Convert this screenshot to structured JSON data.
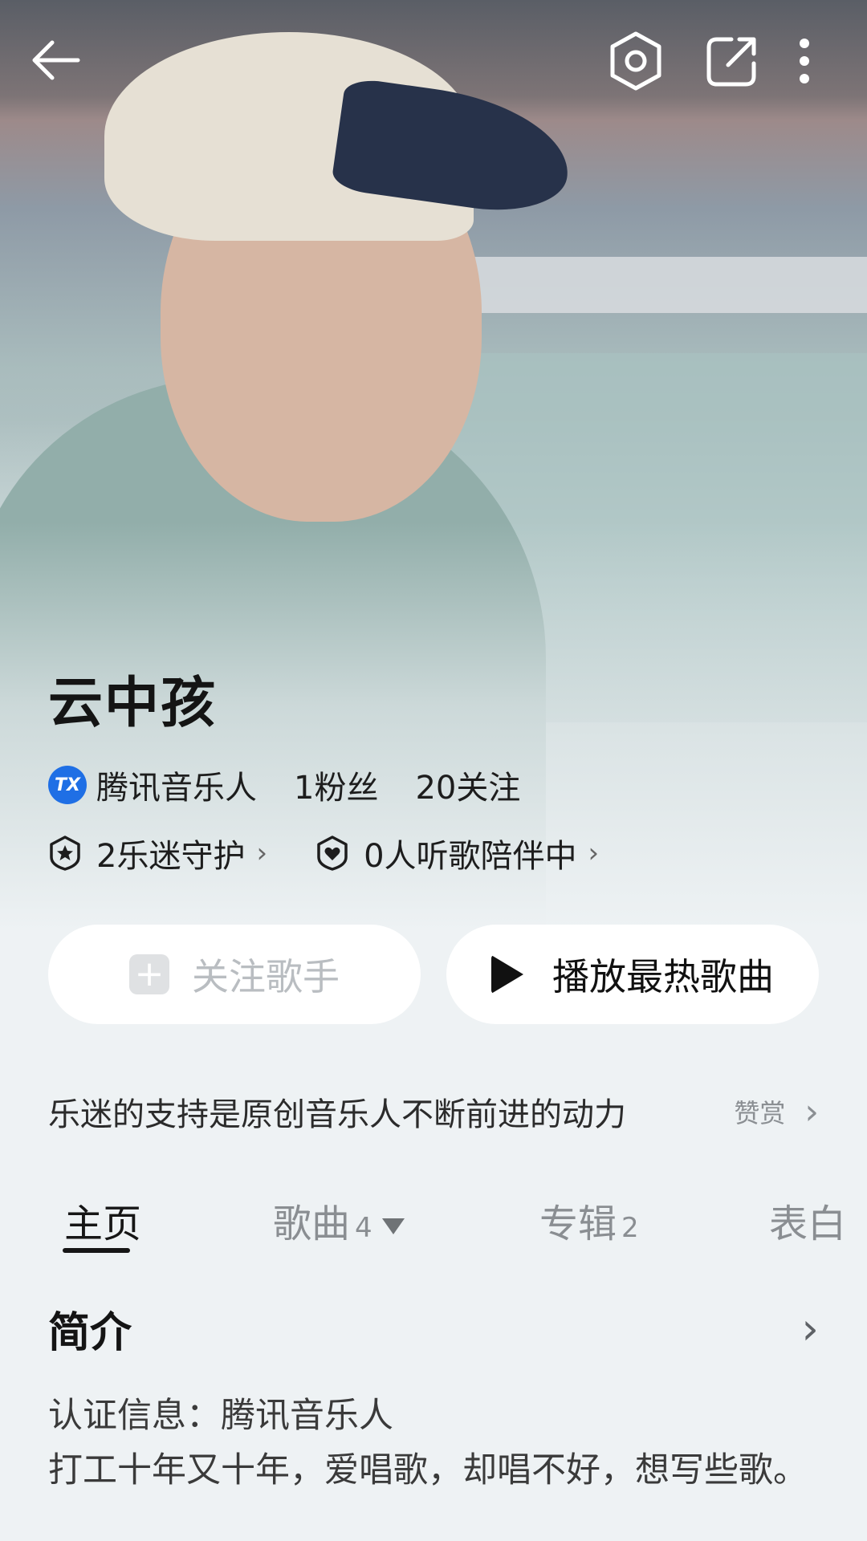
{
  "artist": {
    "name": "云中孩",
    "badge_text": "TX",
    "verification": "腾讯音乐人",
    "fans": "1粉丝",
    "following": "20关注",
    "guardians": "2乐迷守护",
    "listening": "0人听歌陪伴中"
  },
  "actions": {
    "follow_label": "关注歌手",
    "play_label": "播放最热歌曲"
  },
  "support": {
    "text": "乐迷的支持是原创音乐人不断前进的动力",
    "reward_label": "赞赏"
  },
  "tabs": [
    {
      "label": "主页",
      "count": ""
    },
    {
      "label": "歌曲",
      "count": "4"
    },
    {
      "label": "专辑",
      "count": "2"
    },
    {
      "label": "表白",
      "count": ""
    }
  ],
  "intro": {
    "title": "简介",
    "line1": "认证信息：腾讯音乐人",
    "line2": "打工十年又十年，爱唱歌，却唱不好，想写些歌。"
  },
  "icons": {
    "back": "back-arrow-icon",
    "settings": "hexagon-settings-icon",
    "share": "share-icon",
    "more": "more-vertical-icon"
  }
}
